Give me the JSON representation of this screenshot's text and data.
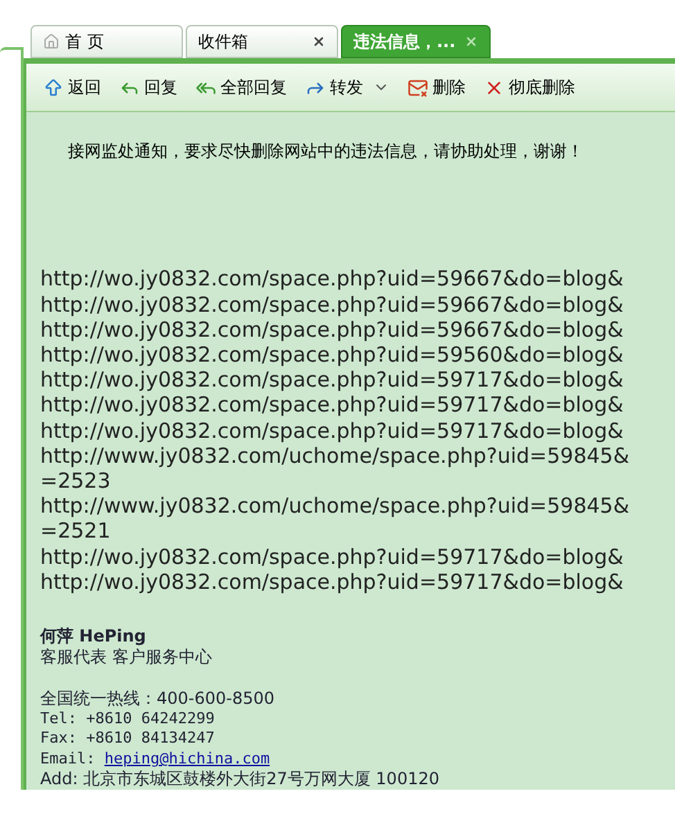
{
  "tabs": [
    {
      "label": "首 页",
      "kind": "home",
      "selected": false
    },
    {
      "label": "收件箱",
      "kind": "closable",
      "selected": false
    },
    {
      "label": "违法信息，...",
      "kind": "closable",
      "selected": true
    }
  ],
  "toolbar": [
    {
      "label": "返回",
      "kind": "back"
    },
    {
      "label": "回复",
      "kind": "reply"
    },
    {
      "label": "全部回复",
      "kind": "reply-all"
    },
    {
      "label": "转发",
      "kind": "forward",
      "dropdown": true
    },
    {
      "label": "删除",
      "kind": "delete"
    },
    {
      "label": "彻底删除",
      "kind": "erase"
    }
  ],
  "message": {
    "notice": "接网监处通知，要求尽快删除网站中的违法信息，请协助处理，谢谢！",
    "links": [
      "http://wo.jy0832.com/space.php?uid=59667&do=blog&",
      "http://wo.jy0832.com/space.php?uid=59667&do=blog&",
      "http://wo.jy0832.com/space.php?uid=59667&do=blog&",
      "http://wo.jy0832.com/space.php?uid=59560&do=blog&",
      "http://wo.jy0832.com/space.php?uid=59717&do=blog&",
      "http://wo.jy0832.com/space.php?uid=59717&do=blog&",
      "http://wo.jy0832.com/space.php?uid=59717&do=blog&",
      "http://www.jy0832.com/uchome/space.php?uid=59845&",
      "=2523",
      "http://www.jy0832.com/uchome/space.php?uid=59845&",
      "=2521",
      "http://wo.jy0832.com/space.php?uid=59717&do=blog&",
      "http://wo.jy0832.com/space.php?uid=59717&do=blog&"
    ],
    "signature": {
      "name": "何萍 HePing",
      "role": "客服代表 客户服务中心",
      "hotline": "全国统一热线：400-600-8500",
      "tel": "Tel: +8610 64242299",
      "fax": "Fax: +8610 84134247",
      "email_label": "Email: ",
      "email": "heping@hichina.com",
      "address": "Add: 北京市东城区鼓楼外大街27号万网大厦 100120"
    }
  }
}
